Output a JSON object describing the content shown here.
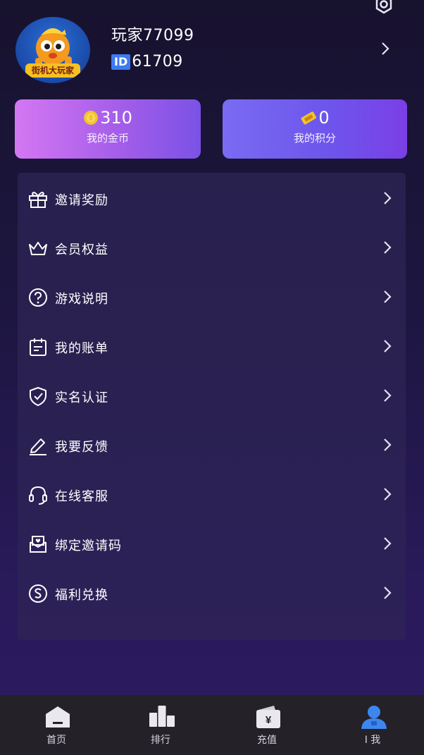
{
  "profile": {
    "username": "玩家77099",
    "id_tag": "ID",
    "id_number": "61709",
    "avatar_badge": "街机大玩家"
  },
  "wallet": {
    "coins": {
      "value": "310",
      "label": "我的金币",
      "icon": "coin-icon"
    },
    "points": {
      "value": "0",
      "label": "我的积分",
      "icon": "ticket-icon"
    }
  },
  "menu": {
    "items": [
      {
        "label": "邀请奖励",
        "icon": "gift-icon"
      },
      {
        "label": "会员权益",
        "icon": "crown-icon"
      },
      {
        "label": "游戏说明",
        "icon": "question-circle-icon"
      },
      {
        "label": "我的账单",
        "icon": "calendar-bill-icon"
      },
      {
        "label": "实名认证",
        "icon": "shield-check-icon"
      },
      {
        "label": "我要反馈",
        "icon": "pen-icon"
      },
      {
        "label": "在线客服",
        "icon": "headset-icon"
      },
      {
        "label": "绑定邀请码",
        "icon": "envelope-heart-icon"
      },
      {
        "label": "福利兑换",
        "icon": "dollar-circle-icon"
      }
    ]
  },
  "tabbar": {
    "tabs": [
      {
        "label": "首页",
        "icon": "home-icon"
      },
      {
        "label": "排行",
        "icon": "ranking-icon"
      },
      {
        "label": "充值",
        "icon": "wallet-yen-icon"
      },
      {
        "label": "I 我",
        "icon": "user-icon"
      }
    ],
    "active_index": 3
  },
  "colors": {
    "accent_blue": "#3d7bf0",
    "coin_gold": "#f3c22c",
    "background": "#1d1640"
  }
}
